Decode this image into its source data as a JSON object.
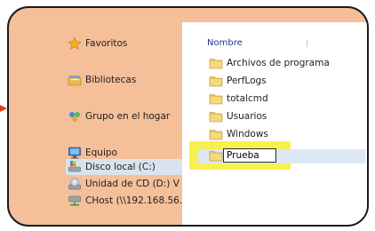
{
  "nav": {
    "favorites": "Favoritos",
    "libraries": "Bibliotecas",
    "homegroup": "Grupo en el hogar",
    "computer": "Equipo",
    "local_disk": "Disco local (C:)",
    "cd_drive": "Unidad de CD (D:) V",
    "network_share": "CHost (\\\\192.168.56."
  },
  "content": {
    "column_header": "Nombre",
    "folders": [
      "Archivos de programa",
      "PerfLogs",
      "totalcmd",
      "Usuarios",
      "Windows"
    ],
    "rename_value": "Prueba"
  },
  "colors": {
    "frame_fill": "#f5bf9a",
    "highlight": "#f6ee3b",
    "arrow": "#e0421c"
  },
  "icons": {
    "favorites": "star-icon",
    "libraries": "library-icon",
    "homegroup": "homegroup-icon",
    "computer": "computer-icon",
    "local_disk": "hard-drive-icon",
    "cd_drive": "cd-drive-icon",
    "network_share": "network-drive-icon",
    "folder": "folder-icon"
  }
}
